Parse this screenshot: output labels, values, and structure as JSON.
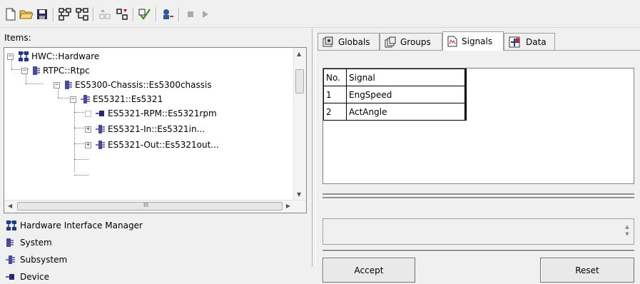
{
  "left_panel": {
    "items_label": "Items:",
    "tree": [
      {
        "label": "HWC::Hardware",
        "expander": "−"
      },
      {
        "label": "RTPC::Rtpc",
        "expander": "−"
      },
      {
        "label": "ES5300-Chassis::Es5300chassis",
        "expander": "−"
      },
      {
        "label": "ES5321::Es5321",
        "expander": "−"
      },
      {
        "label": "ES5321-RPM::Es5321rpm",
        "expander": ""
      },
      {
        "label": "ES5321-In::Es5321in...",
        "expander": "+"
      },
      {
        "label": "ES5321-Out::Es5321out...",
        "expander": "+"
      }
    ],
    "hscroll_grip": "III",
    "legend": [
      {
        "label": "Hardware Interface Manager",
        "icon": "hardware-icon"
      },
      {
        "label": "System",
        "icon": "system-icon"
      },
      {
        "label": "Subsystem",
        "icon": "subsystem-icon"
      },
      {
        "label": "Device",
        "icon": "device-icon"
      }
    ]
  },
  "tabs": [
    {
      "label": "Globals",
      "icon": "globals-icon",
      "active": false
    },
    {
      "label": "Groups",
      "icon": "groups-icon",
      "active": false
    },
    {
      "label": "Signals",
      "icon": "signals-icon",
      "active": true
    },
    {
      "label": "Data",
      "icon": "data-icon",
      "active": false
    }
  ],
  "signals_table": {
    "columns": [
      "No.",
      "Signal"
    ],
    "rows": [
      [
        "1",
        "EngSpeed"
      ],
      [
        "2",
        "ActAngle"
      ]
    ]
  },
  "buttons": {
    "accept": "Accept",
    "reset": "Reset"
  },
  "colors": {
    "background": "#f0f0f0",
    "hardware_icon": "#1e3a8a",
    "system_icon": "#4a4a9a",
    "device_icon": "#26267a"
  }
}
